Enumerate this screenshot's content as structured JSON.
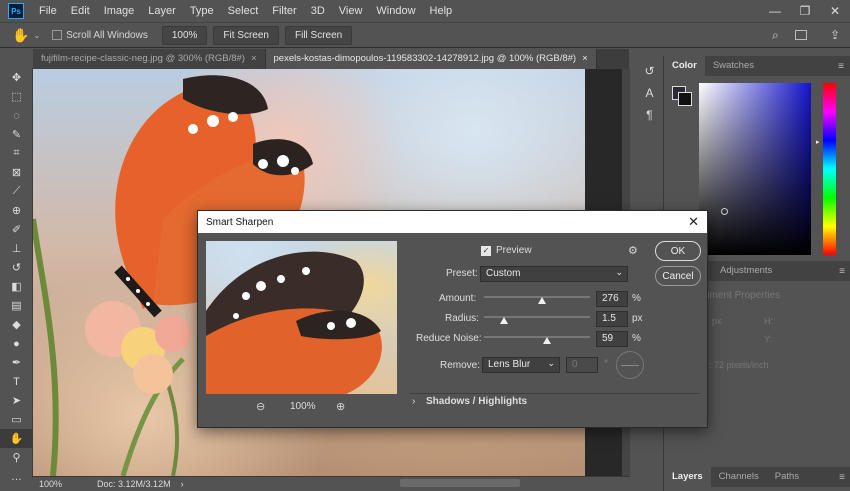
{
  "app": {
    "logo": "Ps"
  },
  "menu": [
    "File",
    "Edit",
    "Image",
    "Layer",
    "Type",
    "Select",
    "Filter",
    "3D",
    "View",
    "Window",
    "Help"
  ],
  "window_controls": {
    "minimize": "—",
    "restore": "❐",
    "close": "✕"
  },
  "options_bar": {
    "scroll_all_windows": "Scroll All Windows",
    "zoom_btn": "100%",
    "fit_screen": "Fit Screen",
    "fill_screen": "Fill Screen"
  },
  "tabs": [
    {
      "label": "fujifilm-recipe-classic-neg.jpg @ 300% (RGB/8#)",
      "close": "×"
    },
    {
      "label": "pexels-kostas-dimopoulos-119583302-14278912.jpg @ 100% (RGB/8#)",
      "close": "×"
    }
  ],
  "status": {
    "zoom": "100%",
    "doc": "Doc: 3.12M/3.12M"
  },
  "right_panel": {
    "color_tabs": [
      "Color",
      "Swatches"
    ],
    "lower_tabs": [
      "Adjustments"
    ],
    "properties_partial": "ument Properties",
    "w_label": "px",
    "h_label": "H:",
    "y_label": "Y:",
    "resolution_partial": ": 72 pixels/inch",
    "bottom_tabs": [
      "Layers",
      "Channels",
      "Paths"
    ]
  },
  "dialog": {
    "title": "Smart Sharpen",
    "close": "✕",
    "preview_label": "Preview",
    "preview_checked": true,
    "preset_label": "Preset:",
    "preset_value": "Custom",
    "amount_label": "Amount:",
    "amount_value": "276",
    "amount_unit": "%",
    "amount_fraction": 0.55,
    "radius_label": "Radius:",
    "radius_value": "1.5",
    "radius_unit": "px",
    "radius_fraction": 0.19,
    "noise_label": "Reduce Noise:",
    "noise_value": "59",
    "noise_unit": "%",
    "noise_fraction": 0.59,
    "remove_label": "Remove:",
    "remove_value": "Lens Blur",
    "angle_value": "0",
    "angle_unit": "°",
    "zoom_value": "100%",
    "ok": "OK",
    "cancel": "Cancel",
    "shadows_highlights": "Shadows / Highlights"
  }
}
